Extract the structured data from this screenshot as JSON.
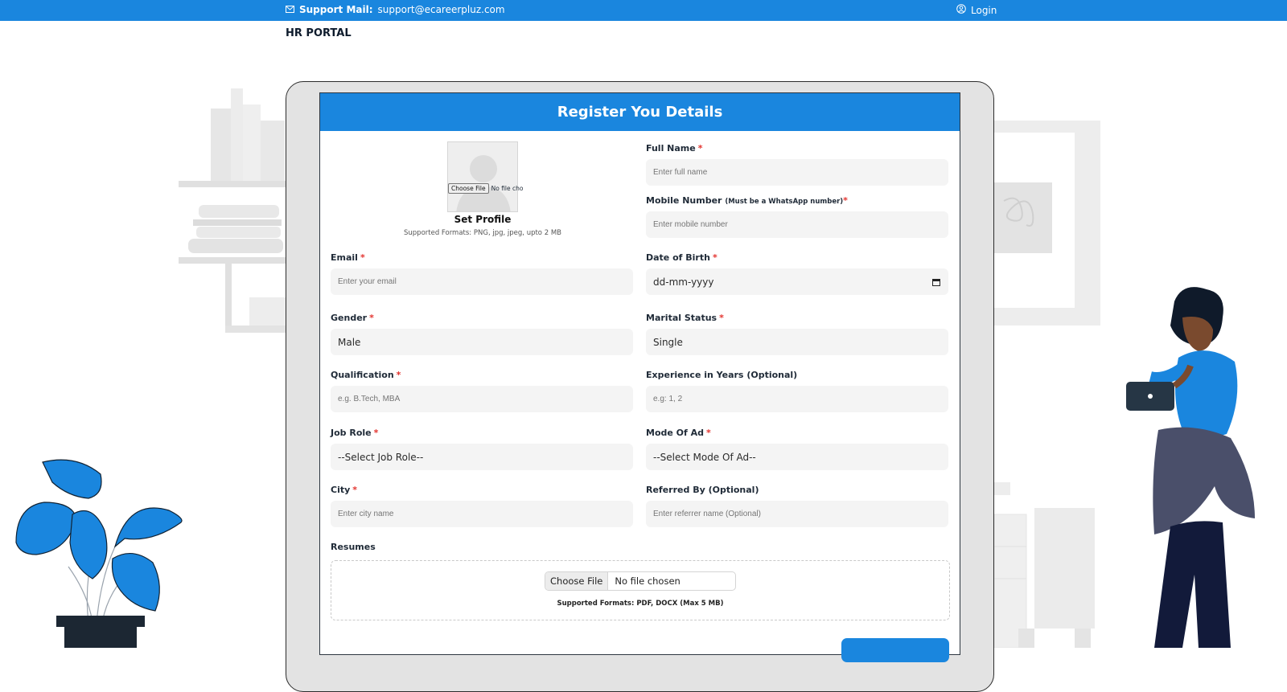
{
  "topbar": {
    "support_label": "Support Mail:",
    "support_email": "support@ecareerpluz.com",
    "login_label": "Login"
  },
  "brand": "HR PORTAL",
  "form": {
    "title": "Register You Details",
    "profile": {
      "choose_label": "Choose File",
      "no_file": "No file cho",
      "set_label": "Set Profile",
      "formats": "Supported Formats: PNG, jpg, jpeg, upto 2 MB"
    },
    "full_name": {
      "label": "Full Name",
      "placeholder": "Enter full name"
    },
    "mobile": {
      "label": "Mobile Number",
      "note": "(Must be a WhatsApp number)",
      "placeholder": "Enter mobile number"
    },
    "email": {
      "label": "Email",
      "placeholder": "Enter your email"
    },
    "dob": {
      "label": "Date of Birth",
      "value": "dd-mm-yyyy"
    },
    "gender": {
      "label": "Gender",
      "value": "Male"
    },
    "marital": {
      "label": "Marital Status",
      "value": "Single"
    },
    "qualification": {
      "label": "Qualification",
      "placeholder": "e.g. B.Tech, MBA"
    },
    "experience": {
      "label": "Experience in Years (Optional)",
      "placeholder": "e.g: 1, 2"
    },
    "job_role": {
      "label": "Job Role",
      "value": "--Select Job Role--"
    },
    "mode_of_ad": {
      "label": "Mode Of Ad",
      "value": "--Select Mode Of Ad--"
    },
    "city": {
      "label": "City",
      "placeholder": "Enter city name"
    },
    "referred_by": {
      "label": "Referred By (Optional)",
      "placeholder": "Enter referrer name (Optional)"
    },
    "resumes": {
      "label": "Resumes",
      "choose_label": "Choose File",
      "no_file": "No file chosen",
      "formats": "Supported Formats: PDF, DOCX (Max 5 MB)"
    },
    "required_mark": "*"
  },
  "colors": {
    "primary": "#1a86de",
    "required": "#e3342f",
    "field_bg": "#f4f4f4"
  }
}
